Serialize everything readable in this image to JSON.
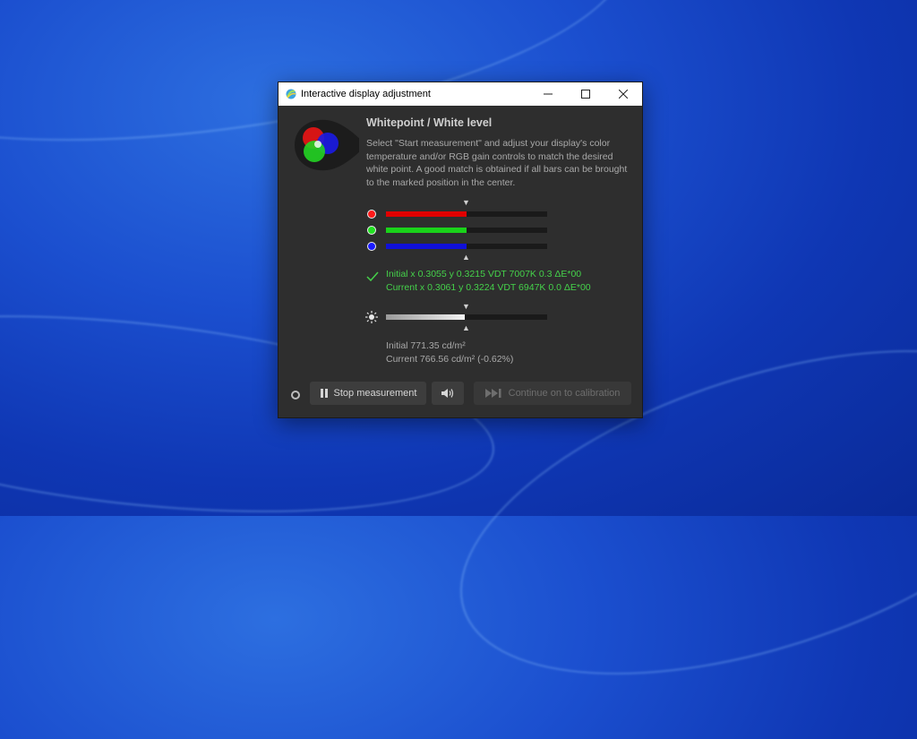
{
  "window": {
    "title": "Interactive display adjustment",
    "controls": {
      "minimize": "—",
      "maximize": "☐",
      "close": "✕"
    }
  },
  "panel": {
    "heading": "Whitepoint / White level",
    "description": "Select \"Start measurement\" and adjust your display's color temperature and/or RGB gain controls to match the desired white point. A good match is obtained if all bars can be brought to the marked position in the center."
  },
  "rgb_bars": [
    {
      "name": "red",
      "color": "#e00000",
      "dot_color": "#ff1a1a",
      "fill_fraction": 0.5
    },
    {
      "name": "green",
      "color": "#1ad21a",
      "dot_color": "#22e022",
      "fill_fraction": 0.5
    },
    {
      "name": "blue",
      "color": "#1010d8",
      "dot_color": "#1a1aff",
      "fill_fraction": 0.5
    }
  ],
  "whitepoint": {
    "initial": "Initial x 0.3055 y 0.3215 VDT 7007K 0.3 ΔE*00",
    "current": "Current x 0.3061 y 0.3224 VDT 6947K 0.0 ΔE*00"
  },
  "luminance": {
    "fill_fraction": 0.49,
    "initial": "Initial 771.35 cd/m²",
    "current": "Current 766.56 cd/m² (-0.62%)"
  },
  "buttons": {
    "stop_measurement": "Stop measurement",
    "continue_calibration": "Continue on to calibration"
  },
  "colors": {
    "accent_green": "#45d14a",
    "window_bg": "#2e2e2e"
  }
}
